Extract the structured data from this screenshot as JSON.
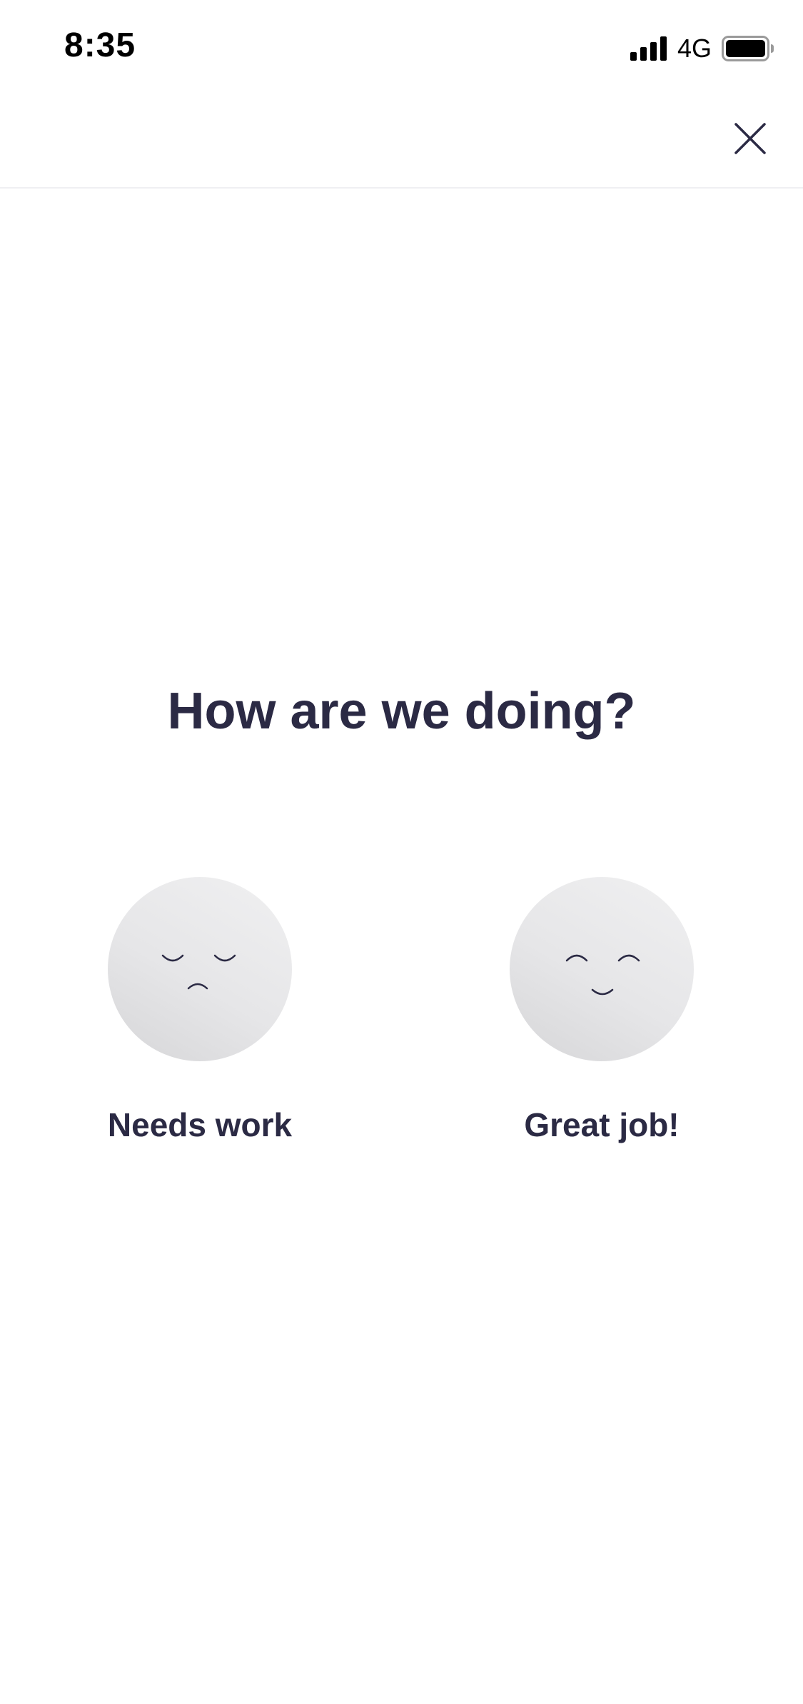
{
  "status_bar": {
    "time": "8:35",
    "network": "4G",
    "signal_icon": "cellular-signal-icon",
    "battery_icon": "battery-full-icon"
  },
  "header": {
    "close_icon": "close-icon"
  },
  "survey": {
    "question": "How are we doing?",
    "options": [
      {
        "label": "Needs work",
        "icon": "sad-face-icon"
      },
      {
        "label": "Great job!",
        "icon": "happy-face-icon"
      }
    ]
  },
  "colors": {
    "text_primary": "#2b2a44",
    "face_fill": "#e6e6e8",
    "background": "#ffffff"
  }
}
